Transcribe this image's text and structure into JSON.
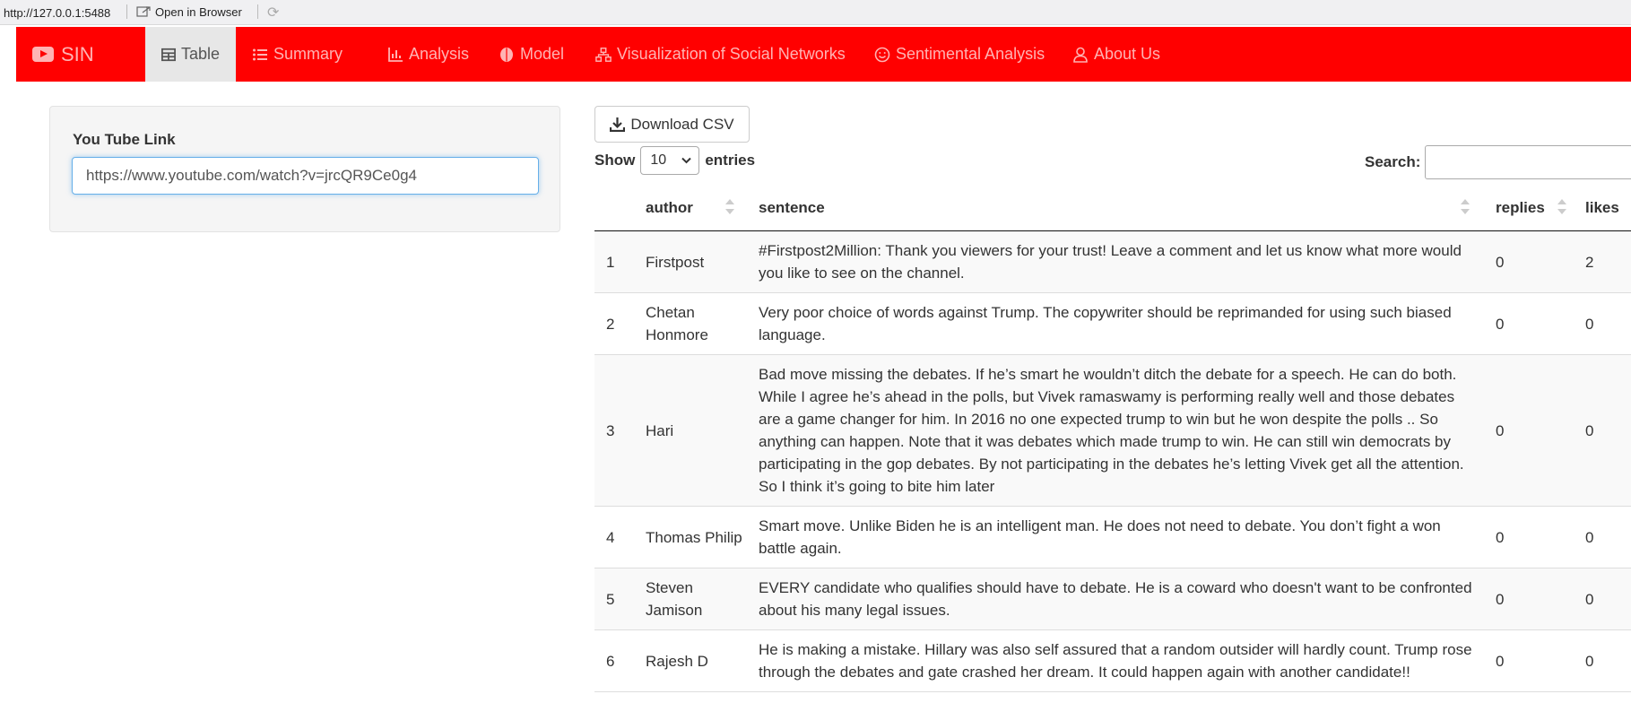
{
  "browser": {
    "url": "http://127.0.0.1:5488",
    "open_in_browser": "Open in Browser"
  },
  "navbar": {
    "brand": "SIN",
    "items": [
      {
        "label": "Table",
        "icon": "table-icon",
        "active": true
      },
      {
        "label": "Summary",
        "icon": "list-icon",
        "active": false
      },
      {
        "label": "Analysis",
        "icon": "bar-chart-icon",
        "active": false
      },
      {
        "label": "Model",
        "icon": "brain-icon",
        "active": false
      },
      {
        "label": "Visualization of Social Networks",
        "icon": "sitemap-icon",
        "active": false
      },
      {
        "label": "Sentimental Analysis",
        "icon": "smile-icon",
        "active": false
      },
      {
        "label": "About Us",
        "icon": "user-icon",
        "active": false
      }
    ]
  },
  "sidebar": {
    "input_label": "You Tube Link",
    "input_value": "https://www.youtube.com/watch?v=jrcQR9Ce0g4"
  },
  "main": {
    "download_label": "Download CSV",
    "show_label": "Show",
    "entries_value": "10",
    "entries_label": "entries",
    "search_label": "Search:",
    "columns": [
      "author",
      "sentence",
      "replies",
      "likes"
    ],
    "rows": [
      {
        "n": "1",
        "author": "Firstpost",
        "sentence": "#Firstpost2Million: Thank you viewers for your trust! Leave a comment and let us know what more would you like to see on the channel.",
        "replies": "0",
        "likes": "2"
      },
      {
        "n": "2",
        "author": "Chetan Honmore",
        "sentence": "Very poor choice of words against Trump. The copywriter should be reprimanded for using such biased language.",
        "replies": "0",
        "likes": "0"
      },
      {
        "n": "3",
        "author": "Hari",
        "sentence": "Bad move missing the debates. If he’s smart he wouldn’t ditch the debate for a speech. He can do both. While I agree he’s ahead in the polls, but Vivek ramaswamy is performing really well and those debates are a game changer for him. In 2016 no one expected trump to win but he won despite the polls .. So anything can happen. Note that it was debates which made trump to win. He can still win democrats by participating in the gop debates. By not participating in the debates he’s letting Vivek get all the attention. So I think it’s going to bite him later",
        "replies": "0",
        "likes": "0"
      },
      {
        "n": "4",
        "author": "Thomas Philip",
        "sentence": "Smart move. Unlike Biden he is an intelligent man. He does not need to debate. You don’t fight a won battle again.",
        "replies": "0",
        "likes": "0"
      },
      {
        "n": "5",
        "author": "Steven Jamison",
        "sentence": "EVERY candidate who qualifies should have to debate. He is a coward who doesn't want to be confronted about his many legal issues.",
        "replies": "0",
        "likes": "0"
      },
      {
        "n": "6",
        "author": "Rajesh D",
        "sentence": "He is making a mistake. Hillary was also self assured that a random outsider will hardly count. Trump rose through the debates and gate crashed her dream. It could happen again with another candidate!!",
        "replies": "0",
        "likes": "0"
      }
    ]
  },
  "colors": {
    "navbar_bg": "#ff0000",
    "nav_text": "#ffb3b3",
    "active_tab_bg": "#e7e7e7"
  }
}
